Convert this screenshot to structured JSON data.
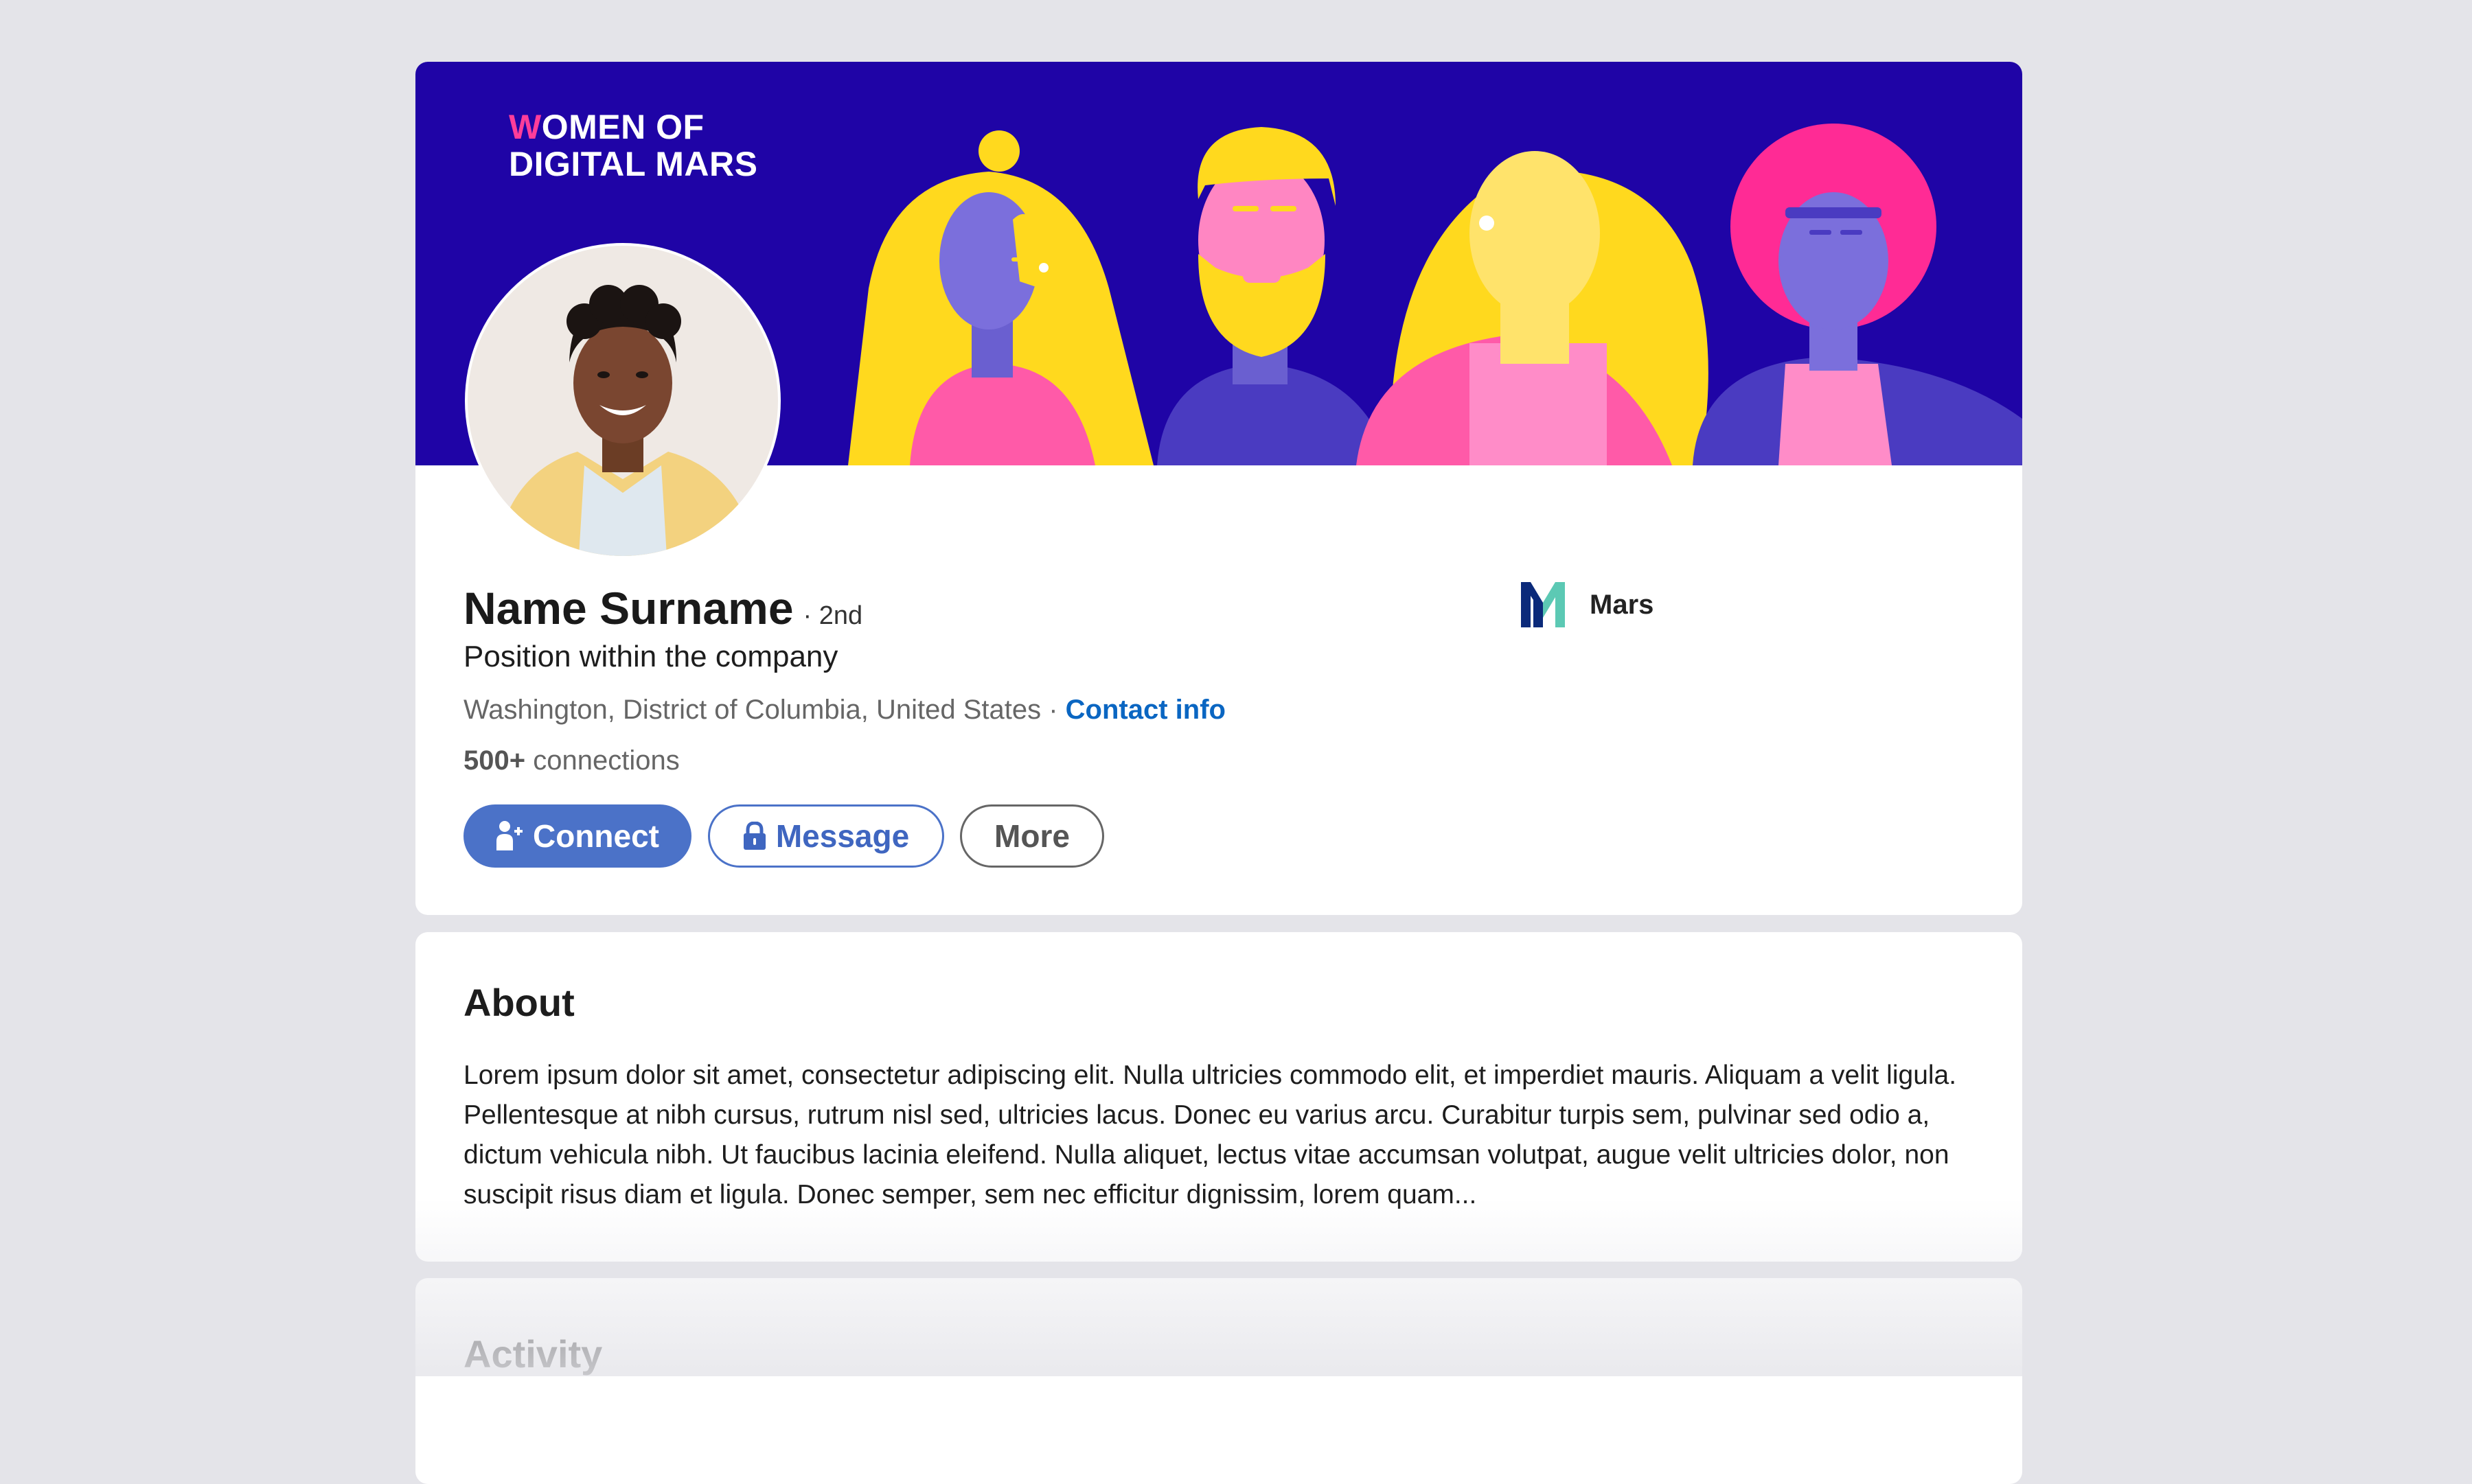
{
  "banner": {
    "brand_line1_first": "W",
    "brand_line1_rest": "OMEN OF",
    "brand_line2": "DIGITAL MARS",
    "background_color": "#1f04a6"
  },
  "profile": {
    "name": "Name Surname",
    "degree": "· 2nd",
    "position": "Position within the company",
    "location": "Washington, District of Columbia, United States",
    "location_separator": " · ",
    "contact_info": "Contact info",
    "connections_count": "500+",
    "connections_label": " connections"
  },
  "company": {
    "name": "Mars",
    "logo_icon": "mars-m-logo-icon"
  },
  "actions": {
    "connect_label": "Connect",
    "message_label": "Message",
    "more_label": "More",
    "connect_icon": "add-person-icon",
    "message_icon": "lock-icon"
  },
  "about": {
    "title": "About",
    "text": "Lorem ipsum dolor sit amet, consectetur adipiscing elit. Nulla ultricies commodo elit, et imperdiet mauris. Aliquam a velit ligula. Pellentesque at nibh cursus, rutrum nisl sed, ultricies lacus. Donec eu varius arcu. Curabitur turpis sem, pulvinar sed odio a, dictum vehicula nibh. Ut faucibus lacinia eleifend. Nulla aliquet, lectus vitae accumsan volutpat, augue velit ultricies dolor, non suscipit risus diam et ligula. Donec semper, sem nec efficitur dignissim, lorem quam..."
  },
  "activity": {
    "title": "Activity"
  },
  "colors": {
    "accent_blue": "#0a66c2",
    "button_blue": "#4b72c8",
    "page_background": "#e4e4e9"
  }
}
